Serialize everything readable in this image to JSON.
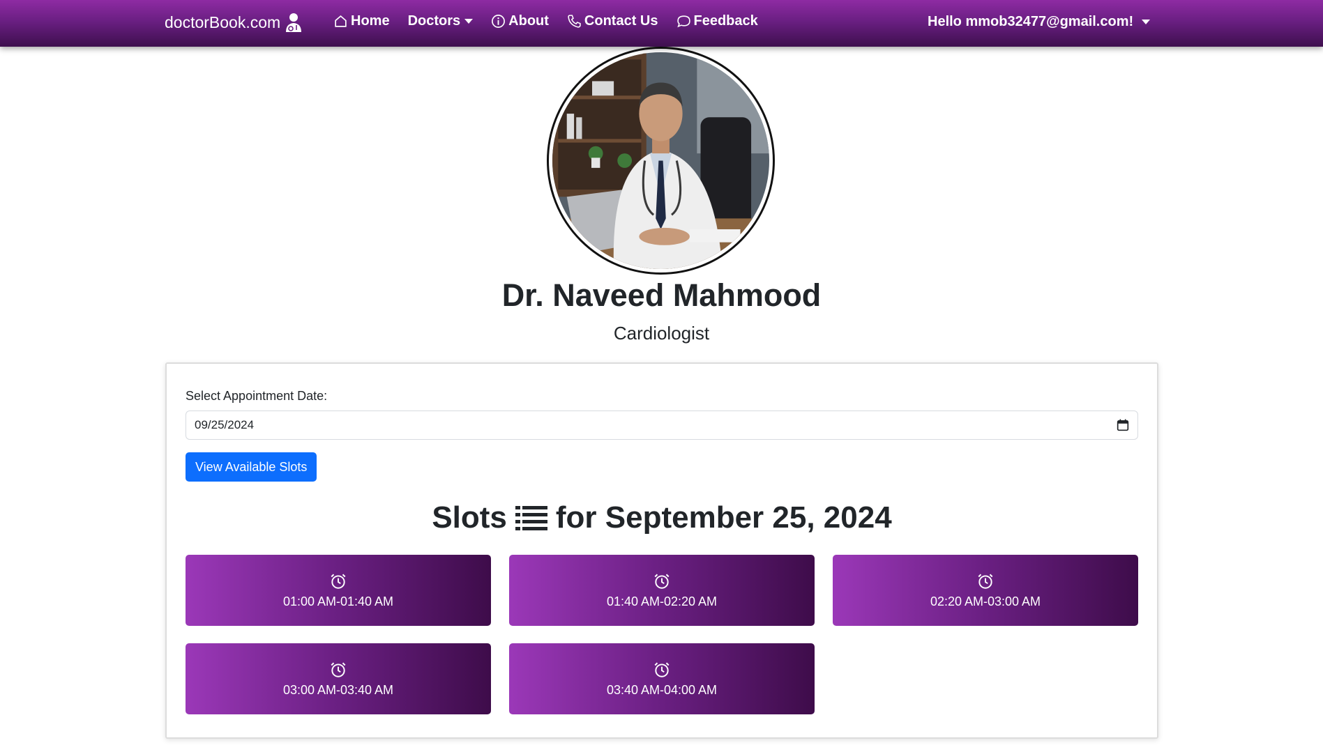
{
  "navbar": {
    "brand": "doctorBook.com",
    "links": {
      "home": "Home",
      "doctors": "Doctors",
      "about": "About",
      "contact": "Contact Us",
      "feedback": "Feedback"
    },
    "user_greeting": "Hello mmob32477@gmail.com!",
    "background_color": "#6a1f82"
  },
  "profile": {
    "name": "Dr. Naveed Mahmood",
    "specialty": "Cardiologist"
  },
  "booking": {
    "date_label": "Select Appointment Date:",
    "date_value": "09/25/2024",
    "view_button": "View Available Slots",
    "button_color": "#0d6efd",
    "heading_prefix": "Slots",
    "heading_suffix": "for September 25, 2024",
    "slots": [
      "01:00 AM-01:40 AM",
      "01:40 AM-02:20 AM",
      "02:20 AM-03:00 AM",
      "03:00 AM-03:40 AM",
      "03:40 AM-04:00 AM"
    ],
    "slot_color": "#6a1f82"
  }
}
